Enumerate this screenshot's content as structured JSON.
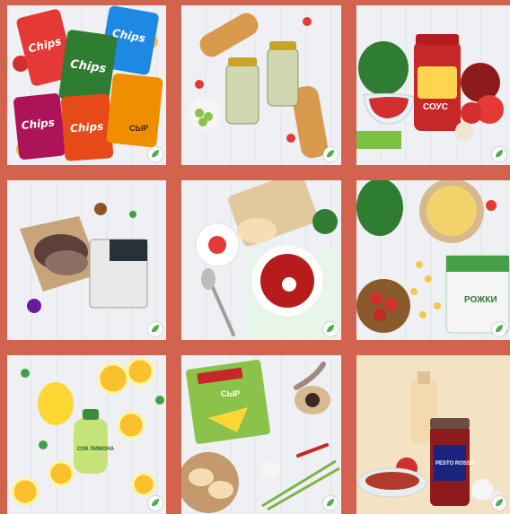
{
  "gallery": {
    "tiles": [
      {
        "id": "chips",
        "brand_labels": [
          "Chips",
          "Chips",
          "Chips",
          "Chips",
          "Chips"
        ],
        "flavor_labels": [
          "СЫР"
        ]
      },
      {
        "id": "olives"
      },
      {
        "id": "sauce",
        "jar_label": "СОУС"
      },
      {
        "id": "meat"
      },
      {
        "id": "borscht"
      },
      {
        "id": "pasta",
        "pack_label": "РОЖКИ"
      },
      {
        "id": "lemon-juice",
        "bottle_label": "СОК ЛИМОНА"
      },
      {
        "id": "cheese",
        "pack_label": "СЫР"
      },
      {
        "id": "pesto",
        "jar_label": "PESTO ROSSO"
      }
    ]
  },
  "colors": {
    "background": "#d1634f",
    "badge_leaf": "#4caf50",
    "accent_red": "#c62828"
  }
}
